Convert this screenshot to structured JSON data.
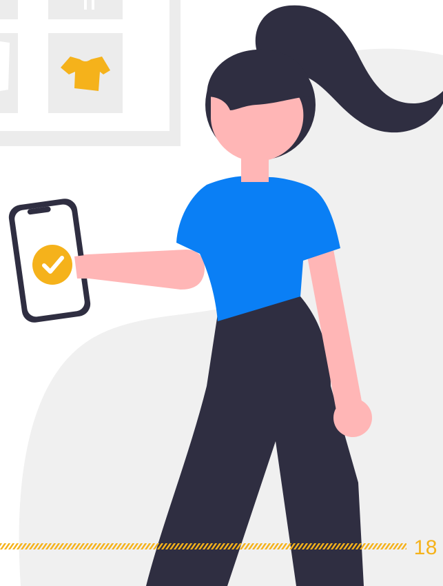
{
  "page": {
    "page_number": "18"
  },
  "colors": {
    "accent_yellow": "#f5b21b",
    "shirt_blue": "#0a7ff5",
    "skin_pink": "#ffb6b6",
    "dark_navy": "#2f2e41",
    "background_grey": "#f0f0f0",
    "frame_grey": "#e8e8e8",
    "white": "#ffffff"
  },
  "icons": {
    "phone_status": "check-icon",
    "wardrobe_item": "tshirt-icon"
  }
}
